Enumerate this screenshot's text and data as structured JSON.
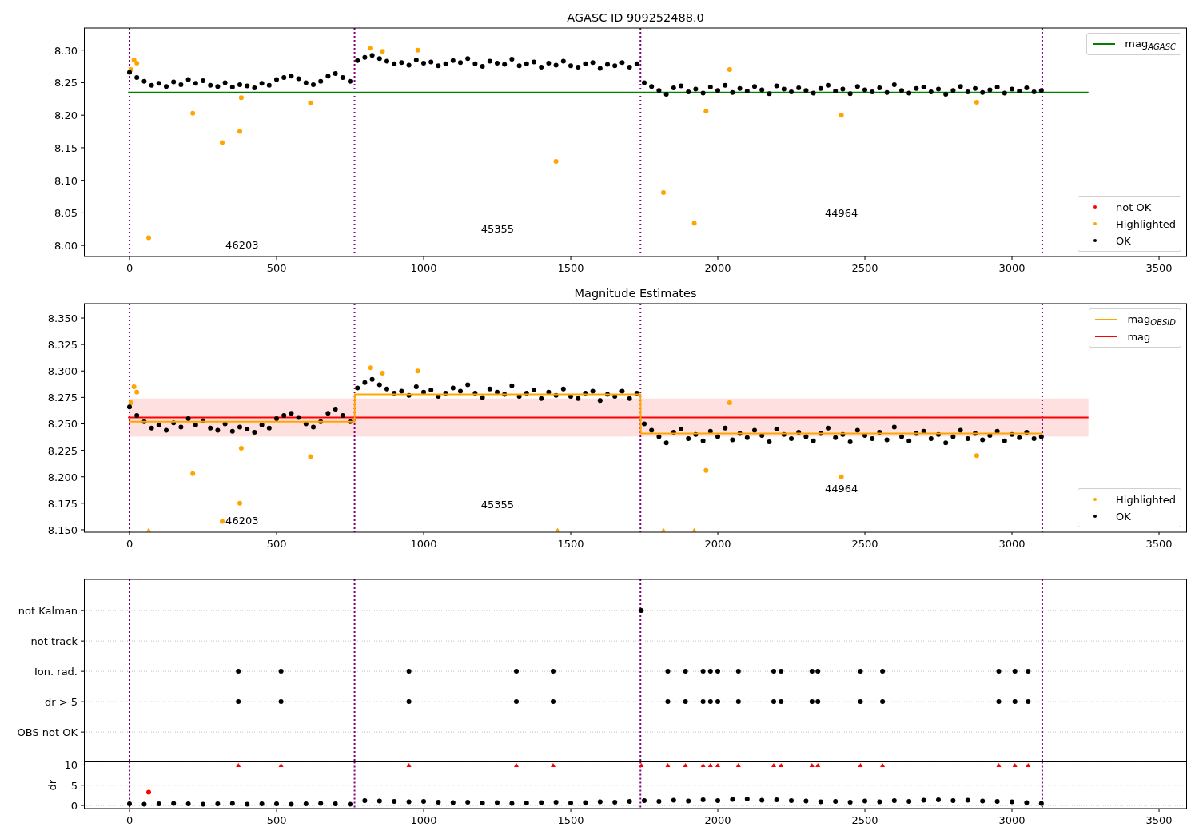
{
  "figure": {
    "panels": [
      {
        "kind": "mag",
        "title": "AGASC ID 909252488.0",
        "chart_data": {
          "type": "scatter",
          "xlim": [
            -155,
            3595
          ],
          "ylim": [
            7.983,
            8.334
          ],
          "xticks": [
            {
              "value": 0,
              "label": "0"
            },
            {
              "value": 500,
              "label": "500"
            },
            {
              "value": 1000,
              "label": "1000"
            },
            {
              "value": 1500,
              "label": "1500"
            },
            {
              "value": 2000,
              "label": "2000"
            },
            {
              "value": 2500,
              "label": "2500"
            },
            {
              "value": 3000,
              "label": "3000"
            },
            {
              "value": 3500,
              "label": "3500"
            }
          ],
          "yticks": [
            {
              "value": 8.0,
              "label": "8.00"
            },
            {
              "value": 8.05,
              "label": "8.05"
            },
            {
              "value": 8.1,
              "label": "8.10"
            },
            {
              "value": 8.15,
              "label": "8.15"
            },
            {
              "value": 8.2,
              "label": "8.20"
            },
            {
              "value": 8.25,
              "label": "8.25"
            },
            {
              "value": 8.3,
              "label": "8.30"
            }
          ],
          "series": [
            {
              "name": "mag$_{AGASC}$",
              "type": "line",
              "color": "#008000",
              "x": [
                -5,
                3260
              ],
              "values": [
                8.235,
                8.235
              ]
            },
            {
              "name": "not OK",
              "type": "scatter",
              "marker": "circle",
              "color": "#ff0000"
            },
            {
              "name": "Highlighted",
              "type": "scatter",
              "marker": "circle",
              "color": "#ffa500",
              "x": [
                5,
                15,
                25,
                65,
                215,
                315,
                375,
                380,
                615,
                820,
                860,
                980,
                1450,
                1815,
                1920,
                1960,
                2040,
                2420,
                2880
              ],
              "values": [
                8.27,
                8.285,
                8.28,
                8.012,
                8.203,
                8.158,
                8.175,
                8.227,
                8.219,
                8.303,
                8.298,
                8.3,
                8.129,
                8.081,
                8.034,
                8.206,
                8.27,
                8.2,
                8.22
              ]
            },
            {
              "name": "OK",
              "type": "scatter",
              "marker": "circle",
              "color": "#000000",
              "x": [
                0,
                25,
                50,
                75,
                100,
                125,
                150,
                175,
                200,
                225,
                250,
                275,
                300,
                325,
                350,
                375,
                400,
                425,
                450,
                475,
                500,
                525,
                550,
                575,
                600,
                625,
                650,
                675,
                700,
                725,
                750,
                775,
                800,
                825,
                850,
                875,
                900,
                925,
                950,
                975,
                1000,
                1025,
                1050,
                1075,
                1100,
                1125,
                1150,
                1175,
                1200,
                1225,
                1250,
                1275,
                1300,
                1325,
                1350,
                1375,
                1400,
                1425,
                1450,
                1475,
                1500,
                1525,
                1550,
                1575,
                1600,
                1625,
                1650,
                1675,
                1700,
                1725,
                1750,
                1775,
                1800,
                1825,
                1850,
                1875,
                1900,
                1925,
                1950,
                1975,
                2000,
                2025,
                2050,
                2075,
                2100,
                2125,
                2150,
                2175,
                2200,
                2225,
                2250,
                2275,
                2300,
                2325,
                2350,
                2375,
                2400,
                2425,
                2450,
                2475,
                2500,
                2525,
                2550,
                2575,
                2600,
                2625,
                2650,
                2675,
                2700,
                2725,
                2750,
                2775,
                2800,
                2825,
                2850,
                2875,
                2900,
                2925,
                2950,
                2975,
                3000,
                3025,
                3050,
                3075,
                3100
              ],
              "values": [
                8.266,
                8.258,
                8.252,
                8.246,
                8.249,
                8.244,
                8.251,
                8.247,
                8.255,
                8.249,
                8.253,
                8.246,
                8.244,
                8.25,
                8.243,
                8.247,
                8.245,
                8.242,
                8.249,
                8.246,
                8.255,
                8.258,
                8.26,
                8.256,
                8.25,
                8.247,
                8.252,
                8.26,
                8.264,
                8.258,
                8.252,
                8.284,
                8.289,
                8.292,
                8.287,
                8.283,
                8.279,
                8.281,
                8.277,
                8.285,
                8.28,
                8.282,
                8.276,
                8.279,
                8.284,
                8.281,
                8.287,
                8.279,
                8.275,
                8.283,
                8.28,
                8.278,
                8.286,
                8.276,
                8.279,
                8.282,
                8.274,
                8.28,
                8.277,
                8.283,
                8.276,
                8.274,
                8.279,
                8.281,
                8.272,
                8.278,
                8.276,
                8.281,
                8.274,
                8.279,
                8.25,
                8.244,
                8.238,
                8.232,
                8.242,
                8.245,
                8.236,
                8.24,
                8.234,
                8.243,
                8.238,
                8.246,
                8.235,
                8.241,
                8.237,
                8.244,
                8.239,
                8.233,
                8.245,
                8.24,
                8.236,
                8.242,
                8.238,
                8.234,
                8.241,
                8.246,
                8.237,
                8.24,
                8.233,
                8.244,
                8.239,
                8.236,
                8.242,
                8.235,
                8.247,
                8.238,
                8.234,
                8.241,
                8.243,
                8.236,
                8.24,
                8.232,
                8.238,
                8.244,
                8.236,
                8.241,
                8.235,
                8.239,
                8.243,
                8.234,
                8.24,
                8.237,
                8.242,
                8.236,
                8.238
              ]
            }
          ],
          "ref_lines": [
            {
              "axis": "x",
              "value": 0
            },
            {
              "axis": "x",
              "value": 765
            },
            {
              "axis": "x",
              "value": 1737
            },
            {
              "axis": "x",
              "value": 3103
            }
          ],
          "annotations": [
            "46203",
            "45355",
            "44964"
          ]
        }
      },
      {
        "kind": "mag",
        "title": "Magnitude Estimates",
        "chart_data": {
          "type": "scatter",
          "xlim": [
            -155,
            3595
          ],
          "ylim": [
            8.1477,
            8.3636
          ],
          "xticks": [
            {
              "value": 0,
              "label": "0"
            },
            {
              "value": 500,
              "label": "500"
            },
            {
              "value": 1000,
              "label": "1000"
            },
            {
              "value": 1500,
              "label": "1500"
            },
            {
              "value": 2000,
              "label": "2000"
            },
            {
              "value": 2500,
              "label": "2500"
            },
            {
              "value": 3000,
              "label": "3000"
            },
            {
              "value": 3500,
              "label": "3500"
            }
          ],
          "yticks": [
            {
              "value": 8.15,
              "label": "8.150"
            },
            {
              "value": 8.175,
              "label": "8.175"
            },
            {
              "value": 8.2,
              "label": "8.200"
            },
            {
              "value": 8.225,
              "label": "8.225"
            },
            {
              "value": 8.25,
              "label": "8.250"
            },
            {
              "value": 8.275,
              "label": "8.275"
            },
            {
              "value": 8.3,
              "label": "8.300"
            },
            {
              "value": 8.325,
              "label": "8.325"
            },
            {
              "value": 8.35,
              "label": "8.350"
            }
          ],
          "bands": [
            {
              "axis": "y",
              "from": 8.238,
              "to": 8.274,
              "color": "#ff0000"
            }
          ],
          "series": [
            {
              "name": "mag",
              "type": "line",
              "color": "#ff0000",
              "x": [
                -5,
                3260
              ],
              "values": [
                8.256,
                8.256
              ]
            },
            {
              "name": "Highlighted",
              "type": "scatter",
              "marker": "circle",
              "color": "#ffa500",
              "x": [
                5,
                15,
                25,
                215,
                315,
                375,
                380,
                615,
                820,
                860,
                980,
                1960,
                2040,
                2420,
                2880
              ],
              "values": [
                8.27,
                8.285,
                8.28,
                8.203,
                8.158,
                8.175,
                8.227,
                8.219,
                8.303,
                8.298,
                8.3,
                8.206,
                8.27,
                8.2,
                8.22
              ]
            },
            {
              "name": "OK",
              "type": "scatter",
              "marker": "circle",
              "color": "#000000",
              "x": [
                0,
                25,
                50,
                75,
                100,
                125,
                150,
                175,
                200,
                225,
                250,
                275,
                300,
                325,
                350,
                375,
                400,
                425,
                450,
                475,
                500,
                525,
                550,
                575,
                600,
                625,
                650,
                675,
                700,
                725,
                750,
                775,
                800,
                825,
                850,
                875,
                900,
                925,
                950,
                975,
                1000,
                1025,
                1050,
                1075,
                1100,
                1125,
                1150,
                1175,
                1200,
                1225,
                1250,
                1275,
                1300,
                1325,
                1350,
                1375,
                1400,
                1425,
                1450,
                1475,
                1500,
                1525,
                1550,
                1575,
                1600,
                1625,
                1650,
                1675,
                1700,
                1725,
                1750,
                1775,
                1800,
                1825,
                1850,
                1875,
                1900,
                1925,
                1950,
                1975,
                2000,
                2025,
                2050,
                2075,
                2100,
                2125,
                2150,
                2175,
                2200,
                2225,
                2250,
                2275,
                2300,
                2325,
                2350,
                2375,
                2400,
                2425,
                2450,
                2475,
                2500,
                2525,
                2550,
                2575,
                2600,
                2625,
                2650,
                2675,
                2700,
                2725,
                2750,
                2775,
                2800,
                2825,
                2850,
                2875,
                2900,
                2925,
                2950,
                2975,
                3000,
                3025,
                3050,
                3075,
                3100
              ],
              "values": [
                8.266,
                8.258,
                8.252,
                8.246,
                8.249,
                8.244,
                8.251,
                8.247,
                8.255,
                8.249,
                8.253,
                8.246,
                8.244,
                8.25,
                8.243,
                8.247,
                8.245,
                8.242,
                8.249,
                8.246,
                8.255,
                8.258,
                8.26,
                8.256,
                8.25,
                8.247,
                8.252,
                8.26,
                8.264,
                8.258,
                8.252,
                8.284,
                8.289,
                8.292,
                8.287,
                8.283,
                8.279,
                8.281,
                8.277,
                8.285,
                8.28,
                8.282,
                8.276,
                8.279,
                8.284,
                8.281,
                8.287,
                8.279,
                8.275,
                8.283,
                8.28,
                8.278,
                8.286,
                8.276,
                8.279,
                8.282,
                8.274,
                8.28,
                8.277,
                8.283,
                8.276,
                8.274,
                8.279,
                8.281,
                8.272,
                8.278,
                8.276,
                8.281,
                8.274,
                8.279,
                8.25,
                8.244,
                8.238,
                8.232,
                8.242,
                8.245,
                8.236,
                8.24,
                8.234,
                8.243,
                8.238,
                8.246,
                8.235,
                8.241,
                8.237,
                8.244,
                8.239,
                8.233,
                8.245,
                8.24,
                8.236,
                8.242,
                8.238,
                8.234,
                8.241,
                8.246,
                8.237,
                8.24,
                8.233,
                8.244,
                8.239,
                8.236,
                8.242,
                8.235,
                8.247,
                8.238,
                8.234,
                8.241,
                8.243,
                8.236,
                8.24,
                8.232,
                8.238,
                8.244,
                8.236,
                8.241,
                8.235,
                8.239,
                8.243,
                8.234,
                8.24,
                8.237,
                8.242,
                8.236,
                8.238
              ]
            },
            {
              "name": "mag$_{OBSID}$",
              "type": "line",
              "color": "#ffa500",
              "x": [
                0,
                765,
                766,
                1737,
                1738,
                3103
              ],
              "values": [
                8.252,
                8.252,
                8.278,
                8.278,
                8.241,
                8.241
              ]
            },
            {
              "type": "scatter",
              "marker": "triangle",
              "color": "#ffa500",
              "x": [
                65,
                1455,
                1815,
                1920
              ],
              "values": [
                8.15,
                8.15,
                8.15,
                8.15
              ]
            }
          ],
          "ref_lines": [
            {
              "axis": "x",
              "value": 0
            },
            {
              "axis": "x",
              "value": 765
            },
            {
              "axis": "x",
              "value": 1737
            },
            {
              "axis": "x",
              "value": 3103
            }
          ],
          "annotations": [
            "46203",
            "45355",
            "44964"
          ]
        }
      },
      {
        "kind": "flags",
        "chart_data": {
          "type": "scatter",
          "orientation": "horizontal",
          "grid": true,
          "xlim": [
            -155,
            3595
          ],
          "categories": [
            "not Kalman",
            "not track",
            "Ion. rad.",
            "dr > 5",
            "OBS not OK"
          ],
          "series": [
            {
              "type": "scatter",
              "marker": "circle",
              "color": "#000000",
              "values": [
                1740,
                null,
                null,
                null,
                null
              ]
            },
            {
              "type": "scatter",
              "marker": "circle",
              "color": "#000000",
              "values": [
                null,
                null,
                370,
                370,
                null
              ]
            },
            {
              "type": "scatter",
              "marker": "circle",
              "color": "#000000",
              "values": [
                null,
                null,
                515,
                515,
                null
              ]
            },
            {
              "type": "scatter",
              "marker": "circle",
              "color": "#000000",
              "values": [
                null,
                null,
                950,
                950,
                null
              ]
            },
            {
              "type": "scatter",
              "marker": "circle",
              "color": "#000000",
              "values": [
                null,
                null,
                1315,
                1315,
                null
              ]
            },
            {
              "type": "scatter",
              "marker": "circle",
              "color": "#000000",
              "values": [
                null,
                null,
                1440,
                1440,
                null
              ]
            },
            {
              "type": "scatter",
              "marker": "circle",
              "color": "#000000",
              "values": [
                null,
                null,
                1830,
                1830,
                null
              ]
            },
            {
              "type": "scatter",
              "marker": "circle",
              "color": "#000000",
              "values": [
                null,
                null,
                1890,
                1890,
                null
              ]
            },
            {
              "type": "scatter",
              "marker": "circle",
              "color": "#000000",
              "values": [
                null,
                null,
                1950,
                1950,
                null
              ]
            },
            {
              "type": "scatter",
              "marker": "circle",
              "color": "#000000",
              "values": [
                null,
                null,
                1975,
                1975,
                null
              ]
            },
            {
              "type": "scatter",
              "marker": "circle",
              "color": "#000000",
              "values": [
                null,
                null,
                2000,
                2000,
                null
              ]
            },
            {
              "type": "scatter",
              "marker": "circle",
              "color": "#000000",
              "values": [
                null,
                null,
                2070,
                2070,
                null
              ]
            },
            {
              "type": "scatter",
              "marker": "circle",
              "color": "#000000",
              "values": [
                null,
                null,
                2190,
                2190,
                null
              ]
            },
            {
              "type": "scatter",
              "marker": "circle",
              "color": "#000000",
              "values": [
                null,
                null,
                2215,
                2215,
                null
              ]
            },
            {
              "type": "scatter",
              "marker": "circle",
              "color": "#000000",
              "values": [
                null,
                null,
                2320,
                2320,
                null
              ]
            },
            {
              "type": "scatter",
              "marker": "circle",
              "color": "#000000",
              "values": [
                null,
                null,
                2340,
                2340,
                null
              ]
            },
            {
              "type": "scatter",
              "marker": "circle",
              "color": "#000000",
              "values": [
                null,
                null,
                2485,
                2485,
                null
              ]
            },
            {
              "type": "scatter",
              "marker": "circle",
              "color": "#000000",
              "values": [
                null,
                null,
                2560,
                2560,
                null
              ]
            },
            {
              "type": "scatter",
              "marker": "circle",
              "color": "#000000",
              "values": [
                null,
                null,
                2955,
                2955,
                null
              ]
            },
            {
              "type": "scatter",
              "marker": "circle",
              "color": "#000000",
              "values": [
                null,
                null,
                3010,
                3010,
                null
              ]
            },
            {
              "type": "scatter",
              "marker": "circle",
              "color": "#000000",
              "values": [
                null,
                null,
                3055,
                3055,
                null
              ]
            }
          ],
          "ref_lines": [
            {
              "axis": "x",
              "value": 0
            },
            {
              "axis": "x",
              "value": 765
            },
            {
              "axis": "x",
              "value": 1737
            },
            {
              "axis": "x",
              "value": 3103
            }
          ]
        }
      },
      {
        "kind": "dr",
        "chart_data": {
          "type": "scatter",
          "ylabel": "dr",
          "grid": true,
          "xlim": [
            -155,
            3595
          ],
          "ylim": [
            -0.78,
            10.78
          ],
          "xticks": [
            {
              "value": 0,
              "label": "0"
            },
            {
              "value": 500,
              "label": "500"
            },
            {
              "value": 1000,
              "label": "1000"
            },
            {
              "value": 1500,
              "label": "1500"
            },
            {
              "value": 2000,
              "label": "2000"
            },
            {
              "value": 2500,
              "label": "2500"
            },
            {
              "value": 3000,
              "label": "3000"
            },
            {
              "value": 3500,
              "label": "3500"
            }
          ],
          "yticks": [
            {
              "value": 0,
              "label": "0"
            },
            {
              "value": 5,
              "label": "5"
            },
            {
              "value": 10,
              "label": "10"
            }
          ],
          "series": [
            {
              "type": "scatter",
              "marker": "circle",
              "color": "#000000",
              "x": [
                0,
                50,
                100,
                150,
                200,
                250,
                300,
                350,
                400,
                450,
                500,
                550,
                600,
                650,
                700,
                750,
                800,
                850,
                900,
                950,
                1000,
                1050,
                1100,
                1150,
                1200,
                1250,
                1300,
                1350,
                1400,
                1450,
                1500,
                1550,
                1600,
                1650,
                1700,
                1750,
                1800,
                1850,
                1900,
                1950,
                2000,
                2050,
                2100,
                2150,
                2200,
                2250,
                2300,
                2350,
                2400,
                2450,
                2500,
                2550,
                2600,
                2650,
                2700,
                2750,
                2800,
                2850,
                2900,
                2950,
                3000,
                3050,
                3100
              ],
              "values": [
                0.4,
                0.3,
                0.4,
                0.5,
                0.4,
                0.3,
                0.4,
                0.5,
                0.3,
                0.4,
                0.4,
                0.3,
                0.4,
                0.5,
                0.4,
                0.3,
                1.2,
                1.1,
                1.0,
                0.9,
                1.0,
                0.8,
                0.7,
                0.8,
                0.6,
                0.7,
                0.5,
                0.6,
                0.7,
                0.8,
                0.6,
                0.7,
                0.9,
                0.8,
                1.0,
                1.2,
                1.0,
                1.3,
                1.1,
                1.4,
                1.2,
                1.5,
                1.6,
                1.3,
                1.4,
                1.2,
                1.1,
                0.9,
                1.0,
                0.8,
                1.1,
                0.9,
                1.2,
                1.0,
                1.3,
                1.4,
                1.2,
                1.3,
                1.1,
                1.0,
                0.9,
                0.7,
                0.5
              ]
            },
            {
              "type": "scatter",
              "marker": "circle",
              "color": "#ff0000",
              "x": [
                65
              ],
              "values": [
                3.3
              ]
            },
            {
              "type": "scatter",
              "marker": "triangle",
              "color": "#ff0000",
              "x": [
                370,
                515,
                950,
                1315,
                1440,
                1740,
                1830,
                1890,
                1950,
                1975,
                2000,
                2070,
                2190,
                2215,
                2320,
                2340,
                2485,
                2560,
                2955,
                3010,
                3055
              ],
              "values": [
                10,
                10,
                10,
                10,
                10,
                10,
                10,
                10,
                10,
                10,
                10,
                10,
                10,
                10,
                10,
                10,
                10,
                10,
                10,
                10,
                10
              ]
            }
          ],
          "ref_lines": [
            {
              "axis": "x",
              "value": 0
            },
            {
              "axis": "x",
              "value": 765
            },
            {
              "axis": "x",
              "value": 1737
            },
            {
              "axis": "x",
              "value": 3103
            }
          ]
        }
      }
    ]
  }
}
